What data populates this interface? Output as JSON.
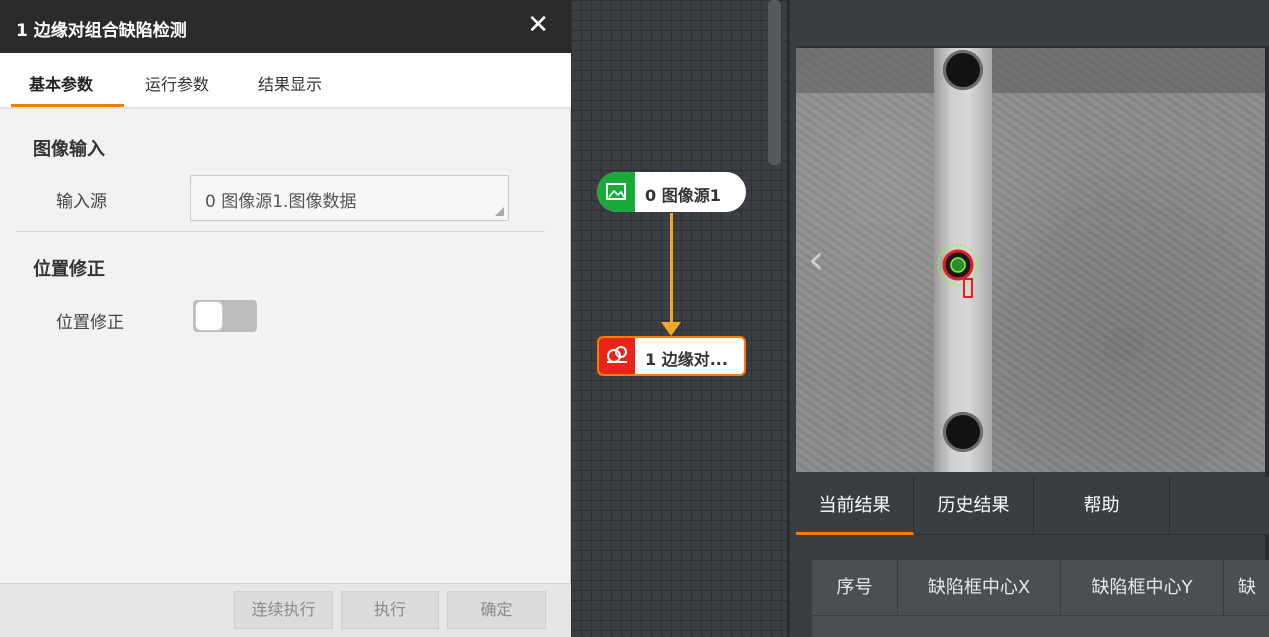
{
  "dialog": {
    "title": "1 边缘对组合缺陷检测",
    "close_icon": "close-icon",
    "tabs": [
      {
        "label": "基本参数",
        "active": true
      },
      {
        "label": "运行参数",
        "active": false
      },
      {
        "label": "结果显示",
        "active": false
      }
    ],
    "section_image_input": "图像输入",
    "input_source_label": "输入源",
    "input_source_value": "0 图像源1.图像数据",
    "section_position": "位置修正",
    "position_label": "位置修正",
    "position_toggle_on": false,
    "buttons": {
      "continuous": "连续执行",
      "run": "执行",
      "confirm": "确定"
    }
  },
  "flow": {
    "node0": {
      "label": "0 图像源1",
      "icon": "image-icon",
      "color": "#1aaa3a"
    },
    "node1": {
      "label": "1 边缘对...",
      "icon": "defect-detect-icon",
      "color": "#e8251b"
    },
    "connector_color": "#f5a623"
  },
  "result_panel": {
    "prev_icon": "chevron-left-icon",
    "tabs": [
      {
        "label": "当前结果",
        "active": true
      },
      {
        "label": "历史结果",
        "active": false
      },
      {
        "label": "帮助",
        "active": false
      }
    ],
    "table_headers": [
      "序号",
      "缺陷框中心X",
      "缺陷框中心Y",
      "缺"
    ]
  },
  "colors": {
    "accent": "#ff7a00",
    "title_bar": "#2b2b2b"
  }
}
